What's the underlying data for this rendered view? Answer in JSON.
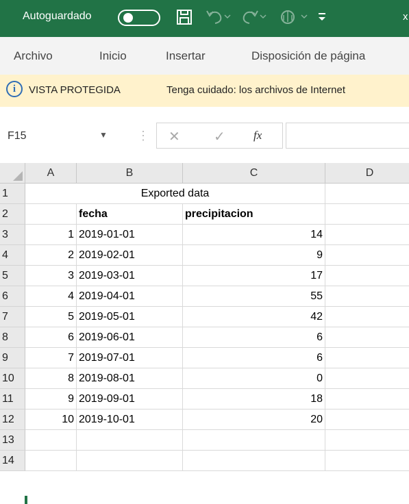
{
  "titlebar": {
    "autosave_label": "Autoguardado",
    "save_icon": "save-icon",
    "undo_icon": "undo-icon",
    "redo_icon": "redo-icon",
    "touch_icon": "touch-mode-icon",
    "customize_icon": "customize-quick-access-icon",
    "overflow_text": "x",
    "color": "#217346"
  },
  "ribbon": {
    "tabs": [
      "Archivo",
      "Inicio",
      "Insertar",
      "Disposición de página"
    ]
  },
  "protected_view": {
    "title": "VISTA PROTEGIDA",
    "message": "Tenga cuidado: los archivos de Internet",
    "icon": "info-icon",
    "bg_color": "#fff2cc"
  },
  "formula_bar": {
    "name_box": "F15",
    "fx": "fx",
    "value": ""
  },
  "grid": {
    "columns": [
      "A",
      "B",
      "C",
      "D"
    ],
    "rows": [
      "1",
      "2",
      "3",
      "4",
      "5",
      "6",
      "7",
      "8",
      "9",
      "10",
      "11",
      "12",
      "13",
      "14"
    ],
    "merged_title": "Exported data",
    "headers": {
      "b": "fecha",
      "c": "precipitacion"
    },
    "data": [
      {
        "a": "1",
        "b": "2019-01-01",
        "c": "14"
      },
      {
        "a": "2",
        "b": "2019-02-01",
        "c": "9"
      },
      {
        "a": "3",
        "b": "2019-03-01",
        "c": "17"
      },
      {
        "a": "4",
        "b": "2019-04-01",
        "c": "55"
      },
      {
        "a": "5",
        "b": "2019-05-01",
        "c": "42"
      },
      {
        "a": "6",
        "b": "2019-06-01",
        "c": "6"
      },
      {
        "a": "7",
        "b": "2019-07-01",
        "c": "6"
      },
      {
        "a": "8",
        "b": "2019-08-01",
        "c": "0"
      },
      {
        "a": "9",
        "b": "2019-09-01",
        "c": "18"
      },
      {
        "a": "10",
        "b": "2019-10-01",
        "c": "20"
      }
    ]
  }
}
